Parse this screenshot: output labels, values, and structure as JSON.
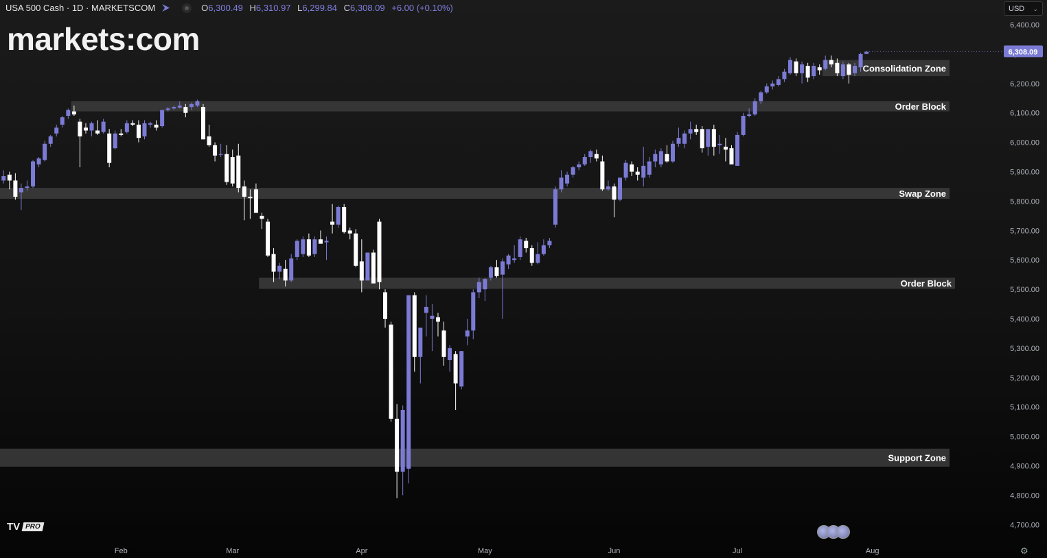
{
  "header": {
    "symbol": "USA 500 Cash · 1D · MARKETSCOM",
    "o_label": "O",
    "o_value": "6,300.49",
    "h_label": "H",
    "h_value": "6,310.97",
    "l_label": "L",
    "l_value": "6,299.84",
    "c_label": "C",
    "c_value": "6,308.09",
    "change": "+6.00 (+0.10%)"
  },
  "logo": {
    "left": "markets",
    "right": "com"
  },
  "currency": {
    "selected": "USD"
  },
  "tv_badge": {
    "brand": "TV",
    "tier": "PRO"
  },
  "icons": [
    "flag-icon",
    "visibility-icon",
    "chevron-down-icon",
    "tradingview-logo-icon",
    "country-flags-icon",
    "settings-icon"
  ],
  "colors": {
    "bullish": "#7b7bd6",
    "bearish": "#ffffff",
    "zone": "#3c3c3c",
    "last_price_tag": "#7b7bd6"
  },
  "chart_data": {
    "type": "candlestick",
    "title": "USA 500 Cash · 1D · MARKETSCOM",
    "y_axis": {
      "ylim": [
        4650,
        6450
      ],
      "ticks": [
        4700,
        4800,
        4900,
        5000,
        5100,
        5200,
        5300,
        5400,
        5500,
        5600,
        5700,
        5800,
        5900,
        6000,
        6100,
        6200,
        6300,
        6400
      ],
      "tick_labels": [
        "4,700.00",
        "4,800.00",
        "4,900.00",
        "5,000.00",
        "5,100.00",
        "5,200.00",
        "5,300.00",
        "5,400.00",
        "5,500.00",
        "5,600.00",
        "5,700.00",
        "5,800.00",
        "5,900.00",
        "6,000.00",
        "6,100.00",
        "6,200.00",
        "6,300.00",
        "6,400.00"
      ],
      "position": "right"
    },
    "x_axis": {
      "month_labels": [
        "Feb",
        "Mar",
        "Apr",
        "May",
        "Jun",
        "Jul",
        "Aug"
      ],
      "month_start_index": [
        20,
        39,
        61,
        82,
        104,
        125,
        148
      ],
      "total_slots": 162
    },
    "last_price": {
      "value": 6308.09,
      "label": "6,308.09"
    },
    "zones": [
      {
        "label": "Consolidation Zone",
        "low": 6225,
        "high": 6280,
        "start_index": 140
      },
      {
        "label": "Order Block",
        "low": 6105,
        "high": 6140,
        "start_index": 12
      },
      {
        "label": "Swap Zone",
        "low": 5808,
        "high": 5845,
        "start_index": 0
      },
      {
        "label": "Order Block",
        "low": 5502,
        "high": 5540,
        "start_index": 44
      },
      {
        "label": "Support Zone",
        "low": 4897,
        "high": 4958,
        "start_index": 0
      }
    ],
    "candles": [
      {
        "o": 5870,
        "h": 5905,
        "l": 5860,
        "c": 5885
      },
      {
        "o": 5890,
        "h": 5900,
        "l": 5840,
        "c": 5870
      },
      {
        "o": 5870,
        "h": 5895,
        "l": 5805,
        "c": 5815
      },
      {
        "o": 5830,
        "h": 5860,
        "l": 5770,
        "c": 5845
      },
      {
        "o": 5845,
        "h": 5870,
        "l": 5835,
        "c": 5850
      },
      {
        "o": 5850,
        "h": 5940,
        "l": 5845,
        "c": 5935
      },
      {
        "o": 5925,
        "h": 5950,
        "l": 5915,
        "c": 5945
      },
      {
        "o": 5940,
        "h": 6005,
        "l": 5935,
        "c": 5995
      },
      {
        "o": 5995,
        "h": 6025,
        "l": 5985,
        "c": 6020
      },
      {
        "o": 6030,
        "h": 6060,
        "l": 6020,
        "c": 6050
      },
      {
        "o": 6060,
        "h": 6090,
        "l": 6050,
        "c": 6085
      },
      {
        "o": 6090,
        "h": 6115,
        "l": 6080,
        "c": 6110
      },
      {
        "o": 6105,
        "h": 6125,
        "l": 6090,
        "c": 6095
      },
      {
        "o": 6070,
        "h": 6080,
        "l": 5915,
        "c": 6020
      },
      {
        "o": 6050,
        "h": 6065,
        "l": 6030,
        "c": 6040
      },
      {
        "o": 6040,
        "h": 6070,
        "l": 6020,
        "c": 6065
      },
      {
        "o": 6040,
        "h": 6075,
        "l": 6025,
        "c": 6030
      },
      {
        "o": 6035,
        "h": 6080,
        "l": 6030,
        "c": 6070
      },
      {
        "o": 6030,
        "h": 6045,
        "l": 5915,
        "c": 5930
      },
      {
        "o": 5980,
        "h": 6040,
        "l": 5975,
        "c": 6030
      },
      {
        "o": 6030,
        "h": 6045,
        "l": 6020,
        "c": 6025
      },
      {
        "o": 6035,
        "h": 6075,
        "l": 6030,
        "c": 6065
      },
      {
        "o": 6065,
        "h": 6075,
        "l": 6055,
        "c": 6060
      },
      {
        "o": 6060,
        "h": 6075,
        "l": 6000,
        "c": 6015
      },
      {
        "o": 6020,
        "h": 6075,
        "l": 6010,
        "c": 6065
      },
      {
        "o": 6060,
        "h": 6070,
        "l": 6050,
        "c": 6065
      },
      {
        "o": 6060,
        "h": 6075,
        "l": 6040,
        "c": 6050
      },
      {
        "o": 6055,
        "h": 6110,
        "l": 6050,
        "c": 6110
      },
      {
        "o": 6110,
        "h": 6120,
        "l": 6105,
        "c": 6115
      },
      {
        "o": 6115,
        "h": 6125,
        "l": 6110,
        "c": 6120
      },
      {
        "o": 6118,
        "h": 6140,
        "l": 6115,
        "c": 6125
      },
      {
        "o": 6120,
        "h": 6130,
        "l": 6085,
        "c": 6100
      },
      {
        "o": 6120,
        "h": 6135,
        "l": 6110,
        "c": 6130
      },
      {
        "o": 6125,
        "h": 6145,
        "l": 6120,
        "c": 6140
      },
      {
        "o": 6120,
        "h": 6130,
        "l": 6010,
        "c": 6010
      },
      {
        "o": 6020,
        "h": 6060,
        "l": 5985,
        "c": 5990
      },
      {
        "o": 5990,
        "h": 6000,
        "l": 5935,
        "c": 5955
      },
      {
        "o": 5960,
        "h": 5995,
        "l": 5950,
        "c": 5960
      },
      {
        "o": 5960,
        "h": 5990,
        "l": 5855,
        "c": 5865
      },
      {
        "o": 5950,
        "h": 5975,
        "l": 5850,
        "c": 5860
      },
      {
        "o": 5955,
        "h": 5995,
        "l": 5830,
        "c": 5845
      },
      {
        "o": 5850,
        "h": 5870,
        "l": 5735,
        "c": 5815
      },
      {
        "o": 5815,
        "h": 5840,
        "l": 5740,
        "c": 5810
      },
      {
        "o": 5840,
        "h": 5860,
        "l": 5760,
        "c": 5760
      },
      {
        "o": 5750,
        "h": 5760,
        "l": 5705,
        "c": 5740
      },
      {
        "o": 5730,
        "h": 5740,
        "l": 5610,
        "c": 5615
      },
      {
        "o": 5620,
        "h": 5640,
        "l": 5525,
        "c": 5560
      },
      {
        "o": 5560,
        "h": 5590,
        "l": 5535,
        "c": 5580
      },
      {
        "o": 5570,
        "h": 5600,
        "l": 5510,
        "c": 5530
      },
      {
        "o": 5530,
        "h": 5620,
        "l": 5525,
        "c": 5605
      },
      {
        "o": 5610,
        "h": 5670,
        "l": 5600,
        "c": 5665
      },
      {
        "o": 5620,
        "h": 5680,
        "l": 5610,
        "c": 5670
      },
      {
        "o": 5670,
        "h": 5690,
        "l": 5610,
        "c": 5615
      },
      {
        "o": 5620,
        "h": 5680,
        "l": 5610,
        "c": 5670
      },
      {
        "o": 5670,
        "h": 5700,
        "l": 5655,
        "c": 5655
      },
      {
        "o": 5660,
        "h": 5680,
        "l": 5600,
        "c": 5665
      },
      {
        "o": 5730,
        "h": 5790,
        "l": 5690,
        "c": 5720
      },
      {
        "o": 5720,
        "h": 5785,
        "l": 5710,
        "c": 5780
      },
      {
        "o": 5780,
        "h": 5790,
        "l": 5690,
        "c": 5695
      },
      {
        "o": 5700,
        "h": 5710,
        "l": 5670,
        "c": 5690
      },
      {
        "o": 5690,
        "h": 5705,
        "l": 5575,
        "c": 5580
      },
      {
        "o": 5595,
        "h": 5670,
        "l": 5490,
        "c": 5530
      },
      {
        "o": 5530,
        "h": 5620,
        "l": 5535,
        "c": 5625
      },
      {
        "o": 5625,
        "h": 5635,
        "l": 5525,
        "c": 5520
      },
      {
        "o": 5730,
        "h": 5740,
        "l": 5500,
        "c": 5525
      },
      {
        "o": 5490,
        "h": 5500,
        "l": 5370,
        "c": 5400
      },
      {
        "o": 5380,
        "h": 5390,
        "l": 5050,
        "c": 5060
      },
      {
        "o": 5060,
        "h": 5110,
        "l": 4790,
        "c": 4880
      },
      {
        "o": 4880,
        "h": 5105,
        "l": 4800,
        "c": 5090
      },
      {
        "o": 4890,
        "h": 5480,
        "l": 4840,
        "c": 5480
      },
      {
        "o": 5480,
        "h": 5490,
        "l": 5220,
        "c": 5270
      },
      {
        "o": 5270,
        "h": 5360,
        "l": 5180,
        "c": 5370
      },
      {
        "o": 5420,
        "h": 5480,
        "l": 5340,
        "c": 5440
      },
      {
        "o": 5400,
        "h": 5450,
        "l": 5290,
        "c": 5410
      },
      {
        "o": 5405,
        "h": 5420,
        "l": 5340,
        "c": 5390
      },
      {
        "o": 5360,
        "h": 5390,
        "l": 5240,
        "c": 5270
      },
      {
        "o": 5260,
        "h": 5310,
        "l": 5220,
        "c": 5300
      },
      {
        "o": 5280,
        "h": 5290,
        "l": 5090,
        "c": 5180
      },
      {
        "o": 5170,
        "h": 5290,
        "l": 5160,
        "c": 5290
      },
      {
        "o": 5340,
        "h": 5400,
        "l": 5310,
        "c": 5360
      },
      {
        "o": 5360,
        "h": 5500,
        "l": 5330,
        "c": 5490
      },
      {
        "o": 5490,
        "h": 5540,
        "l": 5470,
        "c": 5525
      },
      {
        "o": 5500,
        "h": 5540,
        "l": 5460,
        "c": 5535
      },
      {
        "o": 5540,
        "h": 5580,
        "l": 5530,
        "c": 5575
      },
      {
        "o": 5575,
        "h": 5600,
        "l": 5540,
        "c": 5545
      },
      {
        "o": 5550,
        "h": 5605,
        "l": 5400,
        "c": 5595
      },
      {
        "o": 5585,
        "h": 5620,
        "l": 5570,
        "c": 5615
      },
      {
        "o": 5600,
        "h": 5650,
        "l": 5590,
        "c": 5605
      },
      {
        "o": 5610,
        "h": 5680,
        "l": 5600,
        "c": 5670
      },
      {
        "o": 5665,
        "h": 5675,
        "l": 5625,
        "c": 5640
      },
      {
        "o": 5640,
        "h": 5650,
        "l": 5580,
        "c": 5590
      },
      {
        "o": 5590,
        "h": 5660,
        "l": 5585,
        "c": 5620
      },
      {
        "o": 5620,
        "h": 5670,
        "l": 5615,
        "c": 5650
      },
      {
        "o": 5650,
        "h": 5675,
        "l": 5640,
        "c": 5665
      },
      {
        "o": 5720,
        "h": 5850,
        "l": 5710,
        "c": 5840
      },
      {
        "o": 5840,
        "h": 5905,
        "l": 5830,
        "c": 5880
      },
      {
        "o": 5860,
        "h": 5900,
        "l": 5850,
        "c": 5890
      },
      {
        "o": 5890,
        "h": 5920,
        "l": 5880,
        "c": 5915
      },
      {
        "o": 5915,
        "h": 5935,
        "l": 5905,
        "c": 5925
      },
      {
        "o": 5925,
        "h": 5960,
        "l": 5920,
        "c": 5950
      },
      {
        "o": 5950,
        "h": 5975,
        "l": 5930,
        "c": 5970
      },
      {
        "o": 5960,
        "h": 5975,
        "l": 5935,
        "c": 5945
      },
      {
        "o": 5935,
        "h": 5955,
        "l": 5835,
        "c": 5840
      },
      {
        "o": 5840,
        "h": 5870,
        "l": 5835,
        "c": 5850
      },
      {
        "o": 5850,
        "h": 5860,
        "l": 5745,
        "c": 5805
      },
      {
        "o": 5805,
        "h": 5880,
        "l": 5800,
        "c": 5880
      },
      {
        "o": 5880,
        "h": 5940,
        "l": 5870,
        "c": 5930
      },
      {
        "o": 5925,
        "h": 5935,
        "l": 5885,
        "c": 5900
      },
      {
        "o": 5900,
        "h": 5915,
        "l": 5870,
        "c": 5890
      },
      {
        "o": 5880,
        "h": 5985,
        "l": 5850,
        "c": 5920
      },
      {
        "o": 5890,
        "h": 5950,
        "l": 5880,
        "c": 5935
      },
      {
        "o": 5935,
        "h": 5975,
        "l": 5915,
        "c": 5960
      },
      {
        "o": 5925,
        "h": 5980,
        "l": 5915,
        "c": 5970
      },
      {
        "o": 5960,
        "h": 5990,
        "l": 5930,
        "c": 5935
      },
      {
        "o": 5935,
        "h": 6005,
        "l": 5930,
        "c": 5995
      },
      {
        "o": 5995,
        "h": 6050,
        "l": 5985,
        "c": 6015
      },
      {
        "o": 5995,
        "h": 6040,
        "l": 5980,
        "c": 6030
      },
      {
        "o": 6030,
        "h": 6070,
        "l": 6010,
        "c": 6045
      },
      {
        "o": 6045,
        "h": 6060,
        "l": 6025,
        "c": 6035
      },
      {
        "o": 6045,
        "h": 6055,
        "l": 5965,
        "c": 5980
      },
      {
        "o": 5985,
        "h": 6045,
        "l": 5955,
        "c": 6045
      },
      {
        "o": 6045,
        "h": 6060,
        "l": 5955,
        "c": 5985
      },
      {
        "o": 5990,
        "h": 6025,
        "l": 5960,
        "c": 5995
      },
      {
        "o": 5985,
        "h": 6015,
        "l": 5935,
        "c": 5975
      },
      {
        "o": 5980,
        "h": 5990,
        "l": 5940,
        "c": 5925
      },
      {
        "o": 5920,
        "h": 6035,
        "l": 5920,
        "c": 6025
      },
      {
        "o": 6025,
        "h": 6100,
        "l": 6020,
        "c": 6090
      },
      {
        "o": 6090,
        "h": 6115,
        "l": 6085,
        "c": 6095
      },
      {
        "o": 6095,
        "h": 6150,
        "l": 6090,
        "c": 6140
      },
      {
        "o": 6140,
        "h": 6175,
        "l": 6130,
        "c": 6170
      },
      {
        "o": 6170,
        "h": 6200,
        "l": 6165,
        "c": 6190
      },
      {
        "o": 6190,
        "h": 6210,
        "l": 6180,
        "c": 6200
      },
      {
        "o": 6195,
        "h": 6225,
        "l": 6190,
        "c": 6215
      },
      {
        "o": 6215,
        "h": 6250,
        "l": 6205,
        "c": 6240
      },
      {
        "o": 6235,
        "h": 6290,
        "l": 6230,
        "c": 6280
      },
      {
        "o": 6275,
        "h": 6285,
        "l": 6225,
        "c": 6235
      },
      {
        "o": 6235,
        "h": 6275,
        "l": 6200,
        "c": 6265
      },
      {
        "o": 6260,
        "h": 6270,
        "l": 6205,
        "c": 6220
      },
      {
        "o": 6225,
        "h": 6270,
        "l": 6215,
        "c": 6260
      },
      {
        "o": 6255,
        "h": 6265,
        "l": 6230,
        "c": 6245
      },
      {
        "o": 6250,
        "h": 6295,
        "l": 6245,
        "c": 6280
      },
      {
        "o": 6280,
        "h": 6295,
        "l": 6255,
        "c": 6265
      },
      {
        "o": 6270,
        "h": 6285,
        "l": 6225,
        "c": 6235
      },
      {
        "o": 6225,
        "h": 6275,
        "l": 6215,
        "c": 6265
      },
      {
        "o": 6265,
        "h": 6270,
        "l": 6200,
        "c": 6230
      },
      {
        "o": 6235,
        "h": 6270,
        "l": 6225,
        "c": 6260
      },
      {
        "o": 6255,
        "h": 6305,
        "l": 6240,
        "c": 6300
      },
      {
        "o": 6300.49,
        "h": 6310.97,
        "l": 6299.84,
        "c": 6308.09
      }
    ]
  }
}
